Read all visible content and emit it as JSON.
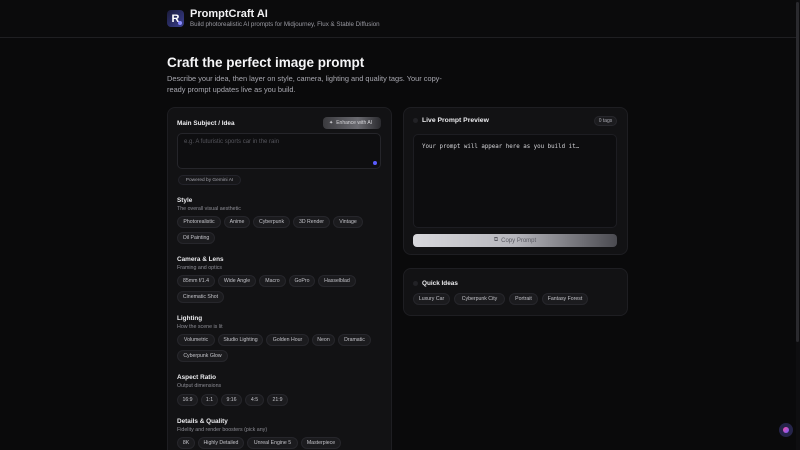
{
  "app": {
    "title": "PromptCraft AI",
    "subtitle": "Build photorealistic AI prompts for Midjourney, Flux & Stable Diffusion",
    "logo_letter": "R",
    "accent": "#5a5cff"
  },
  "hero": {
    "title": "Craft the perfect image prompt",
    "description": "Describe your idea, then layer on style, camera, lighting and quality tags. Your copy-ready prompt updates live as you build."
  },
  "subject": {
    "label": "Main Subject / Idea",
    "enhance_label": "Enhance with AI",
    "placeholder": "e.g. A futuristic sports car in the rain",
    "value": "",
    "powered_by": "Powered by Gemini AI"
  },
  "sections": {
    "style": {
      "label": "Style",
      "description": "The overall visual aesthetic",
      "options": [
        "Photorealistic",
        "Anime",
        "Cyberpunk",
        "3D Render",
        "Vintage",
        "Oil Painting"
      ]
    },
    "camera": {
      "label": "Camera & Lens",
      "description": "Framing and optics",
      "options": [
        "85mm f/1.4",
        "Wide Angle",
        "Macro",
        "GoPro",
        "Hasselblad",
        "Cinematic Shot"
      ]
    },
    "lighting": {
      "label": "Lighting",
      "description": "How the scene is lit",
      "options": [
        "Volumetric",
        "Studio Lighting",
        "Golden Hour",
        "Neon",
        "Dramatic",
        "Cyberpunk Glow"
      ]
    },
    "aspect": {
      "label": "Aspect Ratio",
      "description": "Output dimensions",
      "options": [
        "16:9",
        "1:1",
        "9:16",
        "4:5",
        "21:9"
      ]
    },
    "details": {
      "label": "Details & Quality",
      "description": "Fidelity and render boosters (pick any)",
      "options": [
        "8K",
        "Highly Detailed",
        "Unreal Engine 5",
        "Masterpiece"
      ]
    }
  },
  "preview": {
    "title": "Live Prompt Preview",
    "tag_count": "0 tags",
    "placeholder": "Your prompt will appear here as you build it…",
    "copy_label": "Copy Prompt"
  },
  "quick_ideas": {
    "title": "Quick Ideas",
    "items": [
      "Luxury Car",
      "Cyberpunk City",
      "Portrait",
      "Fantasy Forest"
    ]
  }
}
